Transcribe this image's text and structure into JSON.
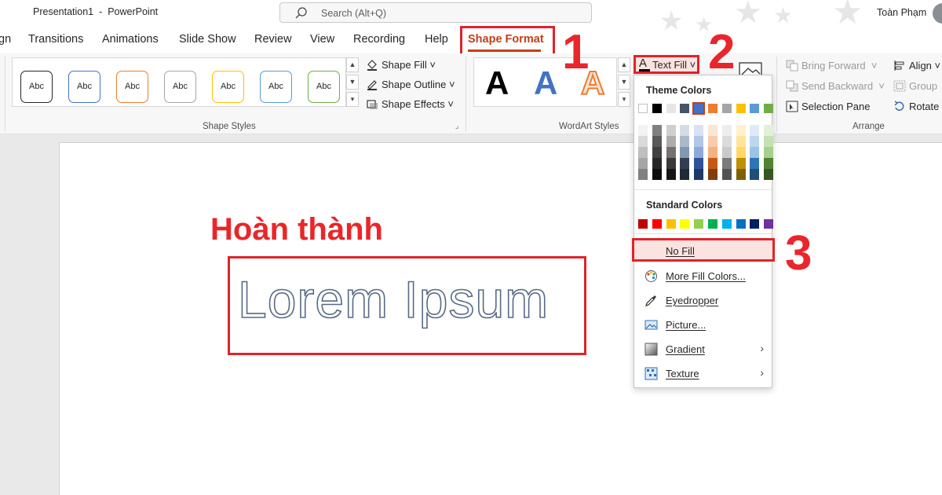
{
  "titlebar": {
    "doc_title": "Presentation1  -  PowerPoint",
    "search_placeholder": "Search (Alt+Q)",
    "user_name": "Toàn Phạm"
  },
  "tabs": [
    {
      "label": "gn"
    },
    {
      "label": "Transitions"
    },
    {
      "label": "Animations"
    },
    {
      "label": "Slide Show"
    },
    {
      "label": "Review"
    },
    {
      "label": "View"
    },
    {
      "label": "Recording"
    },
    {
      "label": "Help"
    },
    {
      "label": "Shape Format"
    }
  ],
  "shape_styles": {
    "label": "Shape Styles",
    "thumbs": [
      {
        "text": "Abc",
        "border": "#262626"
      },
      {
        "text": "Abc",
        "border": "#4472c4"
      },
      {
        "text": "Abc",
        "border": "#ed7d31"
      },
      {
        "text": "Abc",
        "border": "#a5a5a5"
      },
      {
        "text": "Abc",
        "border": "#ffc000"
      },
      {
        "text": "Abc",
        "border": "#5b9bd5"
      },
      {
        "text": "Abc",
        "border": "#70ad47"
      }
    ],
    "shape_fill": "Shape Fill",
    "shape_outline": "Shape Outline",
    "shape_effects": "Shape Effects"
  },
  "wordart": {
    "label": "WordArt Styles",
    "samples": [
      "A",
      "A",
      "A"
    ],
    "text_fill": "Text Fill"
  },
  "arrange": {
    "label": "Arrange",
    "bring_forward": "Bring Forward",
    "send_backward": "Send Backward",
    "selection_pane": "Selection Pane",
    "align": "Align",
    "group": "Group",
    "rotate": "Rotate"
  },
  "dropdown": {
    "theme_colors_label": "Theme Colors",
    "standard_colors_label": "Standard Colors",
    "theme_top": [
      "#ffffff",
      "#000000",
      "#e7e6e6",
      "#44546a",
      "#4472c4",
      "#ed7d31",
      "#a5a5a5",
      "#ffc000",
      "#5b9bd5",
      "#70ad47"
    ],
    "theme_shades": [
      [
        "#f2f2f2",
        "#d9d9d9",
        "#bfbfbf",
        "#a6a6a6",
        "#808080"
      ],
      [
        "#808080",
        "#595959",
        "#404040",
        "#262626",
        "#0d0d0d"
      ],
      [
        "#d0cece",
        "#aeabab",
        "#757171",
        "#3a3838",
        "#171616"
      ],
      [
        "#d6dce4",
        "#adb9ca",
        "#8497b0",
        "#333f50",
        "#222a35"
      ],
      [
        "#d9e2f3",
        "#b4c6e7",
        "#8eaadb",
        "#2f5496",
        "#1f3864"
      ],
      [
        "#fbe5d5",
        "#f7cbac",
        "#f4b183",
        "#c55a11",
        "#833c0b"
      ],
      [
        "#ededed",
        "#dbdbdb",
        "#c9c9c9",
        "#7b7b7b",
        "#525252"
      ],
      [
        "#fff2cc",
        "#ffe599",
        "#ffd965",
        "#bf9000",
        "#7f6000"
      ],
      [
        "#deebf6",
        "#bdd7ee",
        "#9cc3e5",
        "#2e75b5",
        "#1f4e79"
      ],
      [
        "#e2efd9",
        "#c5e0b3",
        "#a8d08d",
        "#538135",
        "#375623"
      ]
    ],
    "standard": [
      "#c00000",
      "#ff0000",
      "#ffc000",
      "#ffff00",
      "#92d050",
      "#00b050",
      "#00b0f0",
      "#0070c0",
      "#002060",
      "#7030a0"
    ],
    "items": [
      {
        "label": "No Fill",
        "icon": "no-fill-icon"
      },
      {
        "label": "More Fill Colors...",
        "icon": "palette-icon"
      },
      {
        "label": "Eyedropper",
        "icon": "eyedropper-icon"
      },
      {
        "label": "Picture...",
        "icon": "picture-icon"
      },
      {
        "label": "Gradient",
        "icon": "gradient-icon"
      },
      {
        "label": "Texture",
        "icon": "texture-icon"
      }
    ]
  },
  "slide": {
    "annotation": "Hoàn thành",
    "text": "Lorem Ipsum"
  },
  "steps": [
    "1",
    "2",
    "3"
  ]
}
